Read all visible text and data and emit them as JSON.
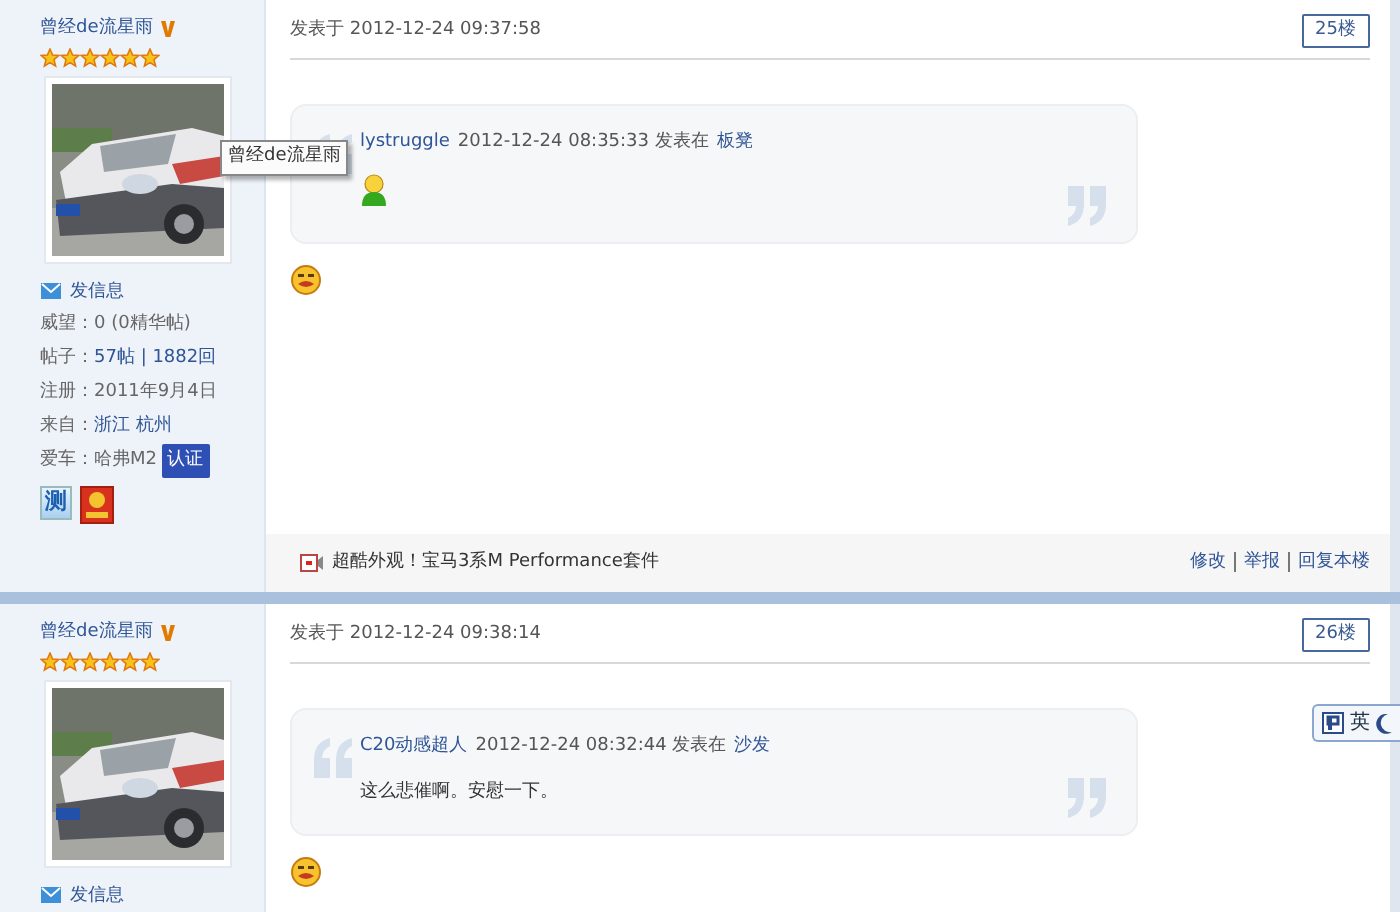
{
  "posts": [
    {
      "author": {
        "name": "曾经de流星雨",
        "verified": true,
        "stars": 6,
        "tooltip": "曾经de流星雨",
        "send_message": "发信息",
        "stats": [
          {
            "label": "威望：",
            "value": "0 (0精华帖)",
            "link": false
          },
          {
            "label": "帖子：",
            "value": "57帖 | 1882回",
            "link": true
          },
          {
            "label": "注册：",
            "value": "2011年9月4日",
            "link": false
          },
          {
            "label": "来自：",
            "value": "浙江 杭州",
            "link": true
          },
          {
            "label": "爱车：",
            "value": "哈弗M2",
            "link": false,
            "tag": "认证"
          }
        ],
        "badge_text": "测"
      },
      "posted": "发表于 2012-12-24 09:37:58",
      "floor": "25楼",
      "quote": {
        "author": "lystruggle",
        "meta": "2012-12-24 08:35:33 发表在",
        "board": "板凳",
        "kind": "emoji"
      },
      "footer": {
        "link": "超酷外观！宝马3系M Performance套件",
        "actions": [
          "修改",
          "举报",
          "回复本楼"
        ]
      }
    },
    {
      "author": {
        "name": "曾经de流星雨",
        "verified": true,
        "stars": 6,
        "send_message": "发信息"
      },
      "posted": "发表于 2012-12-24 09:38:14",
      "floor": "26楼",
      "quote": {
        "author": "C20动感超人",
        "meta": "2012-12-24 08:32:44 发表在",
        "board": "沙发",
        "kind": "text",
        "body": "这么悲催啊。安慰一下。"
      }
    }
  ],
  "ime": {
    "mode": "英"
  }
}
